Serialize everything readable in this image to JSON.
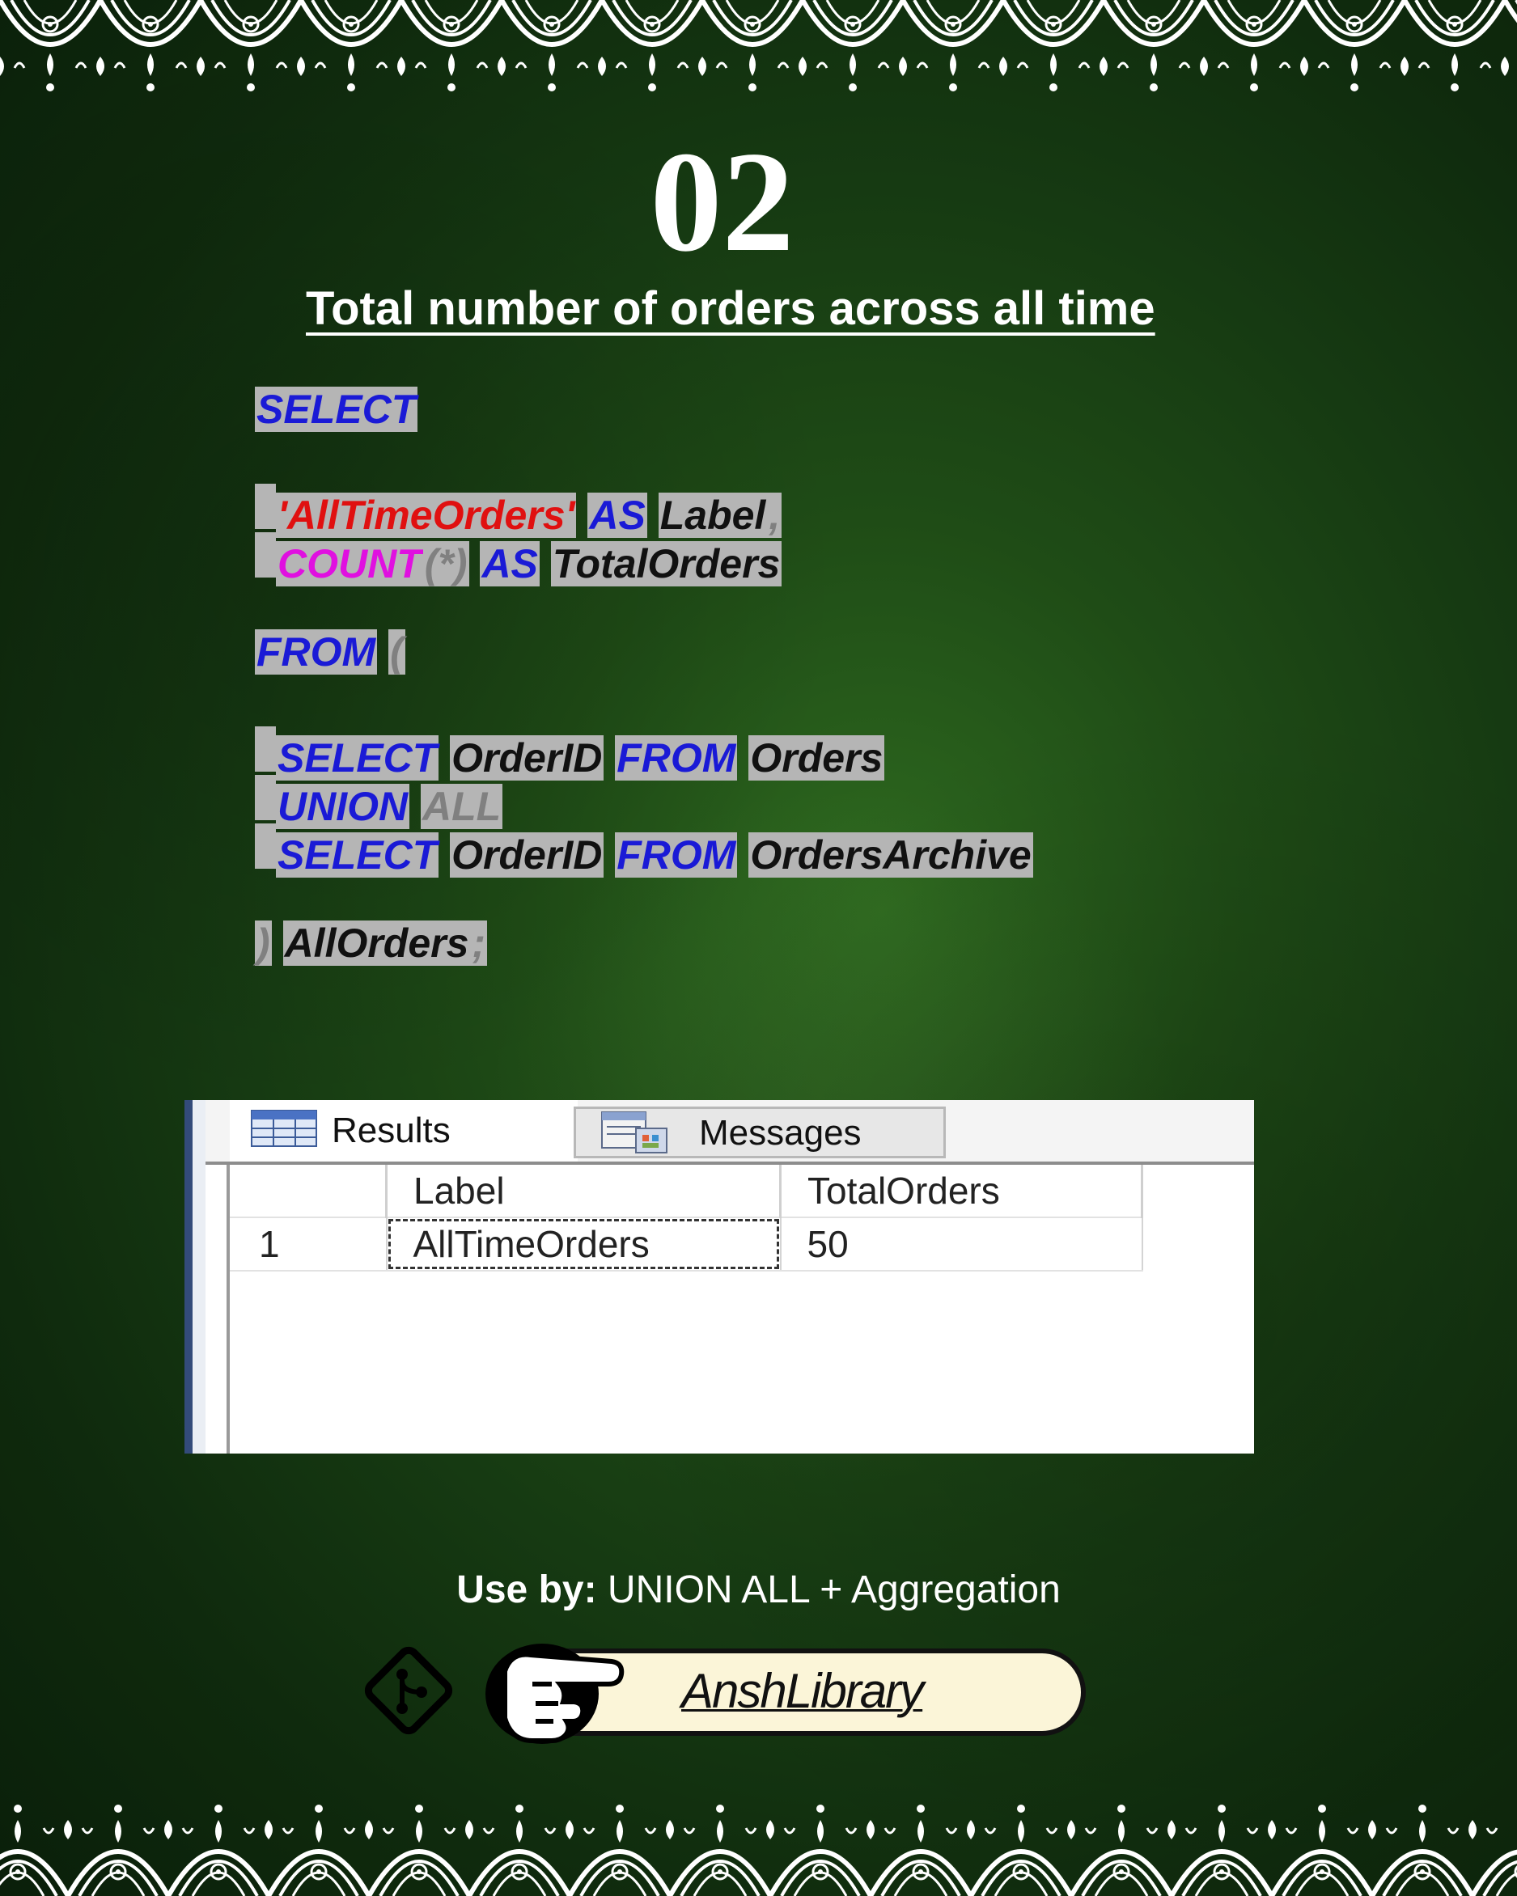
{
  "slide": {
    "number": "02",
    "title": "Total number of orders across all time"
  },
  "code": {
    "line1": {
      "select": "SELECT"
    },
    "line2": {
      "string": "'AllTimeOrders'",
      "as": "AS",
      "label": "Label",
      "comma": ","
    },
    "line3": {
      "count": "COUNT",
      "paren_star": "(*)",
      "as": "AS",
      "alias": "TotalOrders"
    },
    "line4": {
      "from": "FROM",
      "paren": "("
    },
    "line5": {
      "select": "SELECT",
      "col": "OrderID",
      "from": "FROM",
      "table": "Orders"
    },
    "line6": {
      "union": "UNION",
      "all": "ALL"
    },
    "line7": {
      "select": "SELECT",
      "col": "OrderID",
      "from": "FROM",
      "table": "OrdersArchive"
    },
    "line8": {
      "paren": ")",
      "alias": "AllOrders",
      "semi": ";"
    }
  },
  "results": {
    "tabs": [
      {
        "label": "Results",
        "icon": "grid-icon"
      },
      {
        "label": "Messages",
        "icon": "messages-icon"
      }
    ],
    "columns": [
      "",
      "Label",
      "TotalOrders"
    ],
    "rows": [
      {
        "num": "1",
        "label": "AllTimeOrders",
        "total": "50"
      }
    ]
  },
  "footer": {
    "use_by_label": "Use by:",
    "use_by_value": " UNION ALL + Aggregation",
    "brand": "AnshLibrary"
  },
  "colors": {
    "keyword": "#1a1ad6",
    "string": "#e01010",
    "function": "#e010e0",
    "identifier": "#111111",
    "punctuation": "#808080",
    "highlight": "#b5b5b5"
  }
}
